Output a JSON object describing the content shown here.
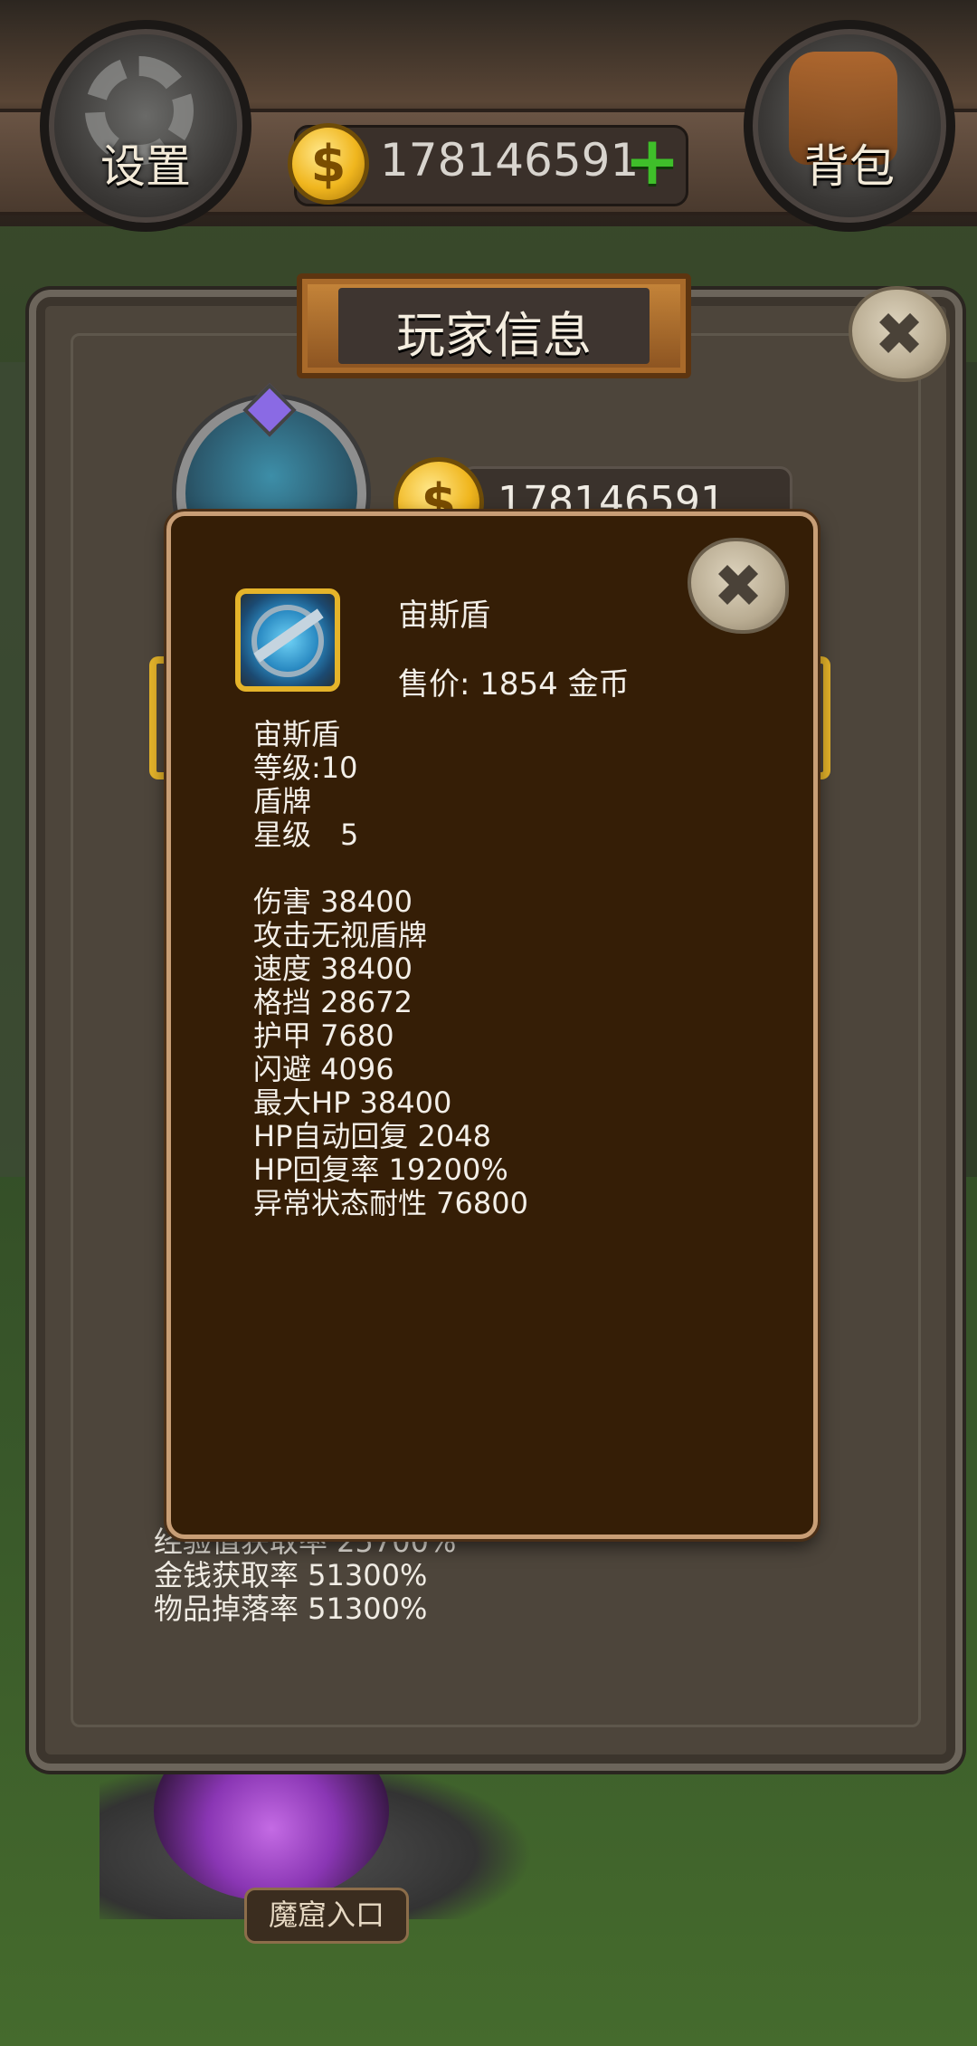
{
  "topbar": {
    "settings_label": "设置",
    "bag_label": "背包",
    "gold_amount": "178146591",
    "currency_symbol": "$",
    "add_gold_symbol": "+"
  },
  "panel": {
    "title": "玩家信息",
    "close_symbol": "✖",
    "gold_amount": "178146591",
    "stats_bottom": [
      "经验值获取率 25700%",
      "金钱获取率 51300%",
      "物品掉落率 51300%"
    ]
  },
  "item_popup": {
    "name": "宙斯盾",
    "price": "售价: 1854 金币",
    "close_symbol": "✖",
    "details": [
      "宙斯盾",
      "等级:10",
      "盾牌",
      "星级　5"
    ],
    "stats": [
      "伤害 38400",
      "攻击无视盾牌",
      "速度 38400",
      "格挡 28672",
      "护甲 7680",
      "闪避 4096",
      "最大HP 38400",
      "HP自动回复 2048",
      "HP回复率 19200%",
      "异常状态耐性 76800"
    ]
  },
  "scene": {
    "cave_label": "魔窟入口"
  }
}
